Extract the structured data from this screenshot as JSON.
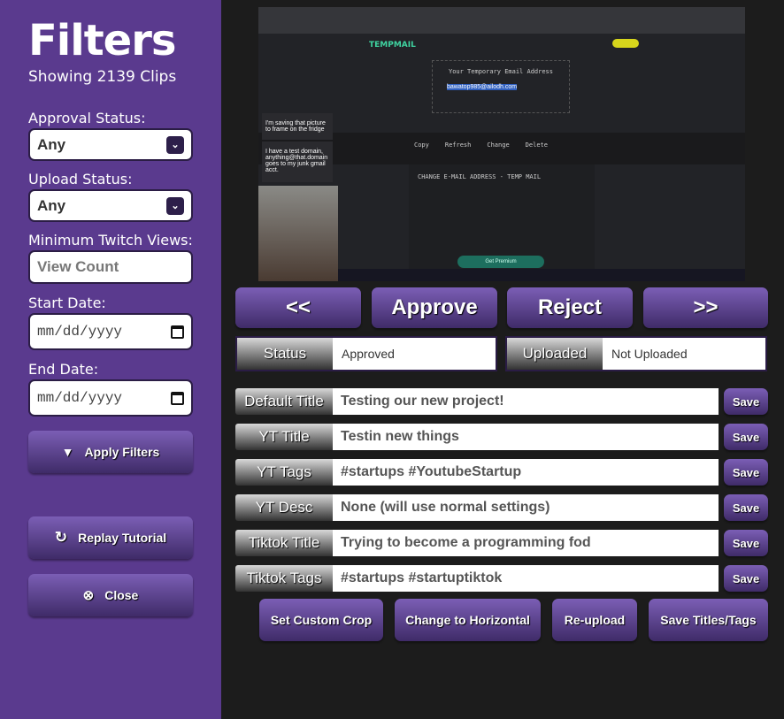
{
  "sidebar": {
    "title": "Filters",
    "showing": "Showing 2139 Clips",
    "approval_label": "Approval Status:",
    "approval_value": "Any",
    "upload_label": "Upload Status:",
    "upload_value": "Any",
    "views_label": "Minimum Twitch Views:",
    "views_placeholder": "View Count",
    "start_label": "Start Date:",
    "start_placeholder": "mm/dd/yyyy",
    "end_label": "End Date:",
    "end_placeholder": "mm/dd/yyyy",
    "apply": "Apply Filters",
    "replay": "Replay Tutorial",
    "close": "Close"
  },
  "video": {
    "brand": "TEMPMAIL",
    "heading": "Your Temporary Email Address",
    "email": "bawatop985@ailodh.com",
    "section": "CHANGE E-MAIL ADDRESS - TEMP MAIL",
    "actions": [
      "Copy",
      "Refresh",
      "Change",
      "Delete"
    ],
    "button": "Get Premium",
    "chat": [
      {
        "text": "I'm saving that picture to frame on the fridge"
      },
      {
        "text": "I have a test domain, anything@that.domain goes to my junk gmail acct."
      }
    ]
  },
  "nav": {
    "prev": "<<",
    "approve": "Approve",
    "reject": "Reject",
    "next": ">>"
  },
  "status": {
    "status_label": "Status",
    "status_value": "Approved",
    "uploaded_label": "Uploaded",
    "uploaded_value": "Not Uploaded"
  },
  "fields": [
    {
      "label": "Default Title",
      "value": "Testing our new project!"
    },
    {
      "label": "YT Title",
      "value": "Testin new things"
    },
    {
      "label": "YT Tags",
      "value": "#startups #YoutubeStartup"
    },
    {
      "label": "YT Desc",
      "value": "None (will use normal settings)"
    },
    {
      "label": "Tiktok Title",
      "value": "Trying to become a programming fod"
    },
    {
      "label": "Tiktok Tags",
      "value": "#startups #startuptiktok"
    }
  ],
  "save_label": "Save",
  "actions": {
    "crop": "Set Custom Crop",
    "horizontal": "Change to Horizontal",
    "reupload": "Re-upload",
    "save_all": "Save Titles/Tags"
  },
  "colors": {
    "sidebar": "#5a3a8e",
    "button_top": "#7b5eb5",
    "button_bottom": "#3f2b68",
    "background": "#1c1c1c"
  }
}
